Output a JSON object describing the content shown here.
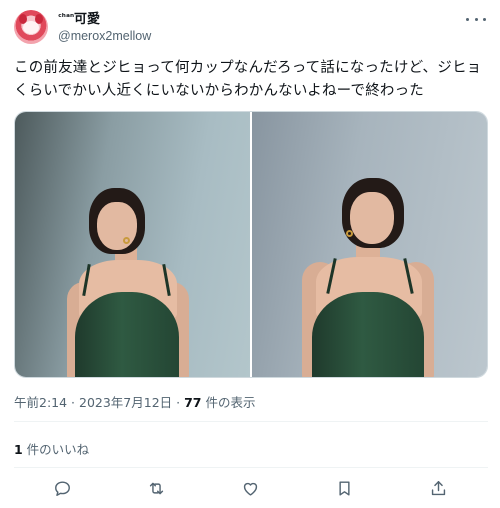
{
  "user": {
    "display_name_prefix": "ᶜʰᵃⁿ",
    "display_name": "可愛",
    "handle": "@merox2mellow"
  },
  "tweet": {
    "text": "この前友達とジヒョって何カップなんだろって話になったけど、ジヒョくらいでかい人近くにいないからわかんないよねーで終わった"
  },
  "meta": {
    "time": "午前2:14",
    "separator1": " · ",
    "date": "2023年7月12日",
    "separator2": " · ",
    "views_count": "77",
    "views_label": " 件の表示"
  },
  "likes": {
    "count": "1",
    "label": " 件のいいね"
  },
  "icons": {
    "more": "more-icon",
    "reply": "reply-icon",
    "retweet": "retweet-icon",
    "like": "like-icon",
    "bookmark": "bookmark-icon",
    "share": "share-icon"
  },
  "colors": {
    "text": "#0f1419",
    "secondary": "#536471",
    "border": "#cfd9de",
    "dress": "#2f5a42"
  }
}
